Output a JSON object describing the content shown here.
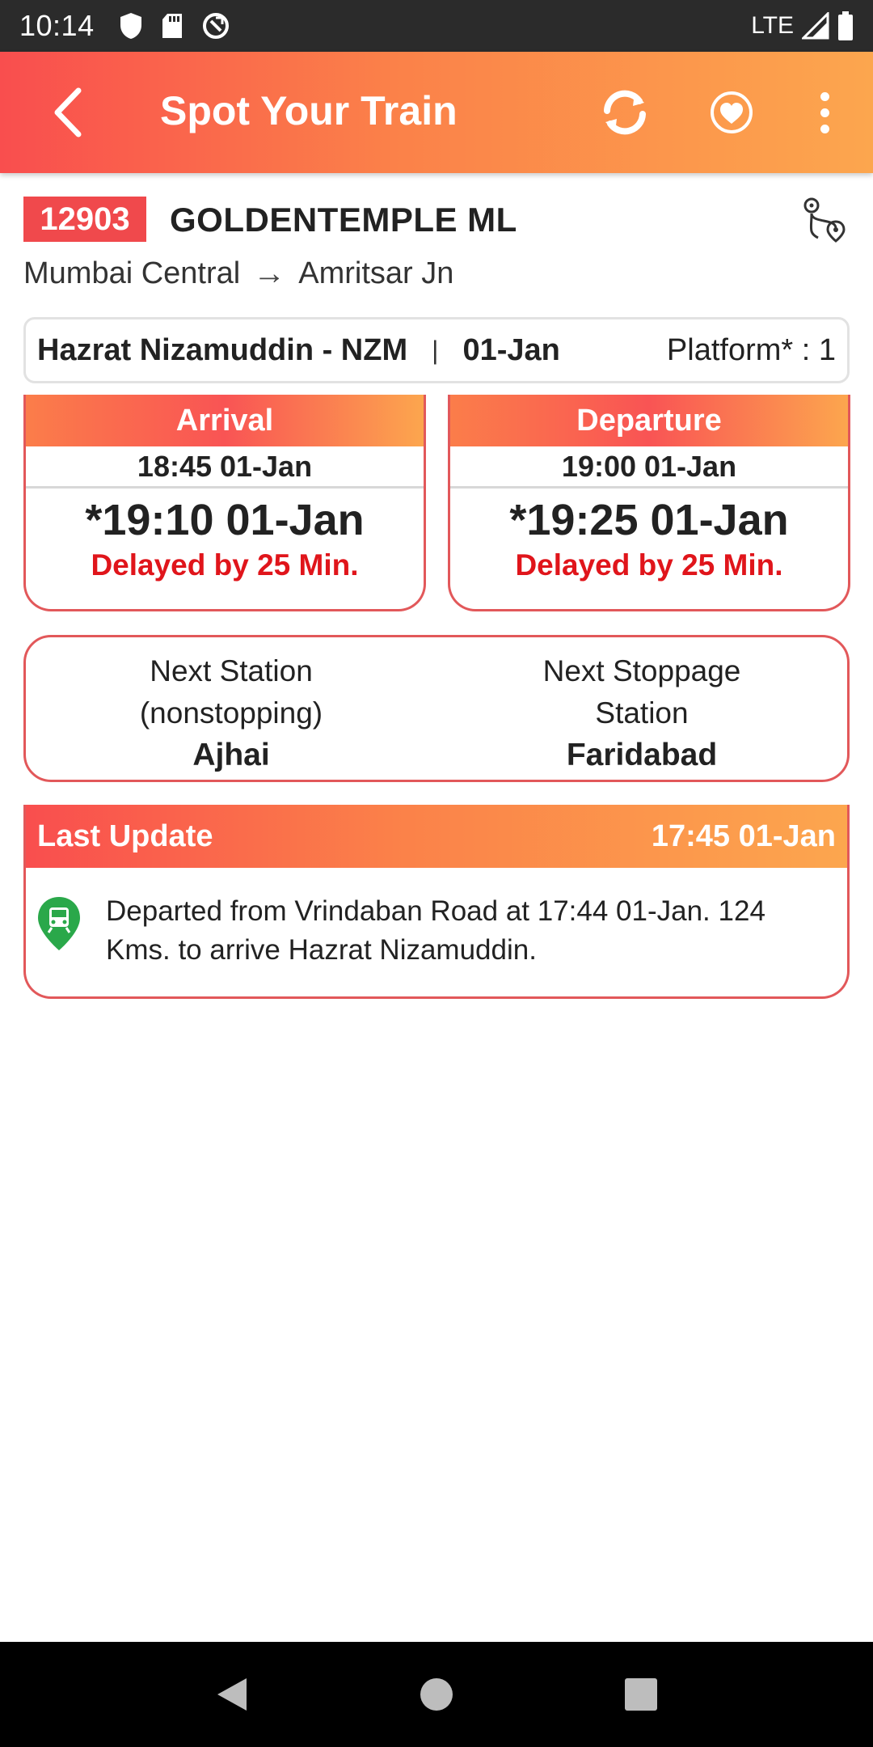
{
  "status_bar": {
    "time": "10:14",
    "network": "LTE"
  },
  "app_bar": {
    "title": "Spot Your Train"
  },
  "train": {
    "number": "12903",
    "name": "GOLDENTEMPLE ML",
    "from": "Mumbai Central",
    "to": "Amritsar Jn"
  },
  "station": {
    "name": "Hazrat Nizamuddin - NZM",
    "separator": "|",
    "date": "01-Jan",
    "platform": "Platform* : 1"
  },
  "arrival": {
    "label": "Arrival",
    "scheduled": "18:45 01-Jan",
    "actual": "*19:10 01-Jan",
    "delay": "Delayed by 25 Min."
  },
  "departure": {
    "label": "Departure",
    "scheduled": "19:00 01-Jan",
    "actual": "*19:25 01-Jan",
    "delay": "Delayed by 25 Min."
  },
  "next": {
    "station_label_1": "Next Station",
    "station_label_2": "(nonstopping)",
    "station_value": "Ajhai",
    "stoppage_label_1": "Next Stoppage",
    "stoppage_label_2": "Station",
    "stoppage_value": "Faridabad"
  },
  "last_update": {
    "label": "Last Update",
    "time": "17:45 01-Jan",
    "message": "Departed from Vrindaban Road at 17:44 01-Jan. 124 Kms. to arrive Hazrat Nizamuddin."
  },
  "colors": {
    "accent_red": "#f0494c",
    "accent_orange": "#fca64e",
    "delay_red": "#e0151b",
    "pin_green": "#2aa84a"
  },
  "icons": {
    "back": "chevron-left-icon",
    "refresh": "refresh-icon",
    "favorite": "heart-icon",
    "more": "more-vertical-icon",
    "route": "route-map-icon",
    "pin": "train-location-pin-icon"
  }
}
